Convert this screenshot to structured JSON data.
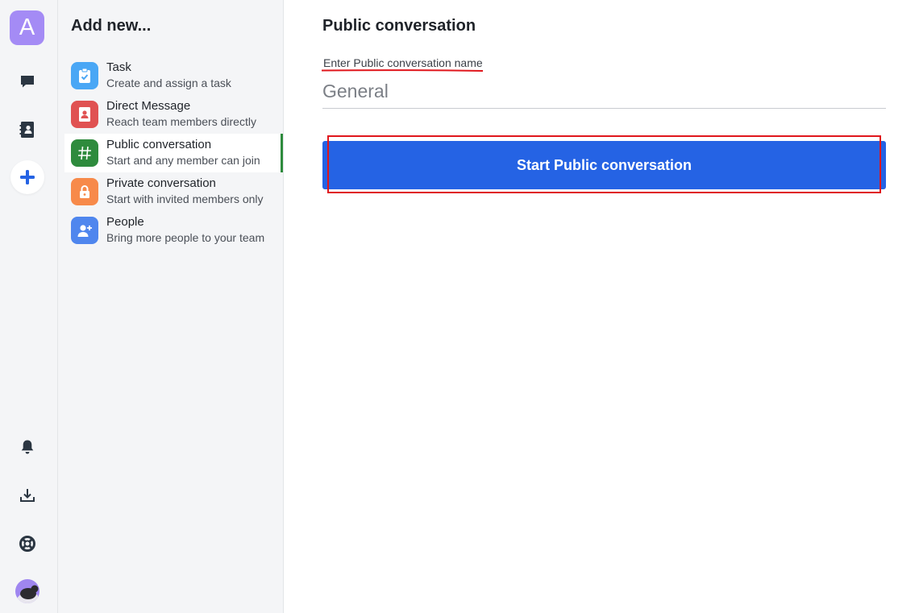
{
  "rail": {
    "workspace_initial": "A",
    "items": [
      {
        "name": "chat-bubble-icon"
      },
      {
        "name": "contacts-book-icon"
      },
      {
        "name": "plus-icon",
        "active": true
      },
      {
        "name": "bell-icon"
      },
      {
        "name": "download-icon"
      },
      {
        "name": "lifebuoy-icon"
      }
    ]
  },
  "panel": {
    "title": "Add new...",
    "items": [
      {
        "label": "Task",
        "description": "Create and assign a task",
        "icon": "clipboard-check-icon",
        "color": "#4aa7f5"
      },
      {
        "label": "Direct Message",
        "description": "Reach team members directly",
        "icon": "contact-card-icon",
        "color": "#e05252"
      },
      {
        "label": "Public conversation",
        "description": "Start and any member can join",
        "icon": "hash-icon",
        "color": "#2e8b3d",
        "selected": true
      },
      {
        "label": "Private conversation",
        "description": "Start with invited members only",
        "icon": "lock-icon",
        "color": "#f78a4a"
      },
      {
        "label": "People",
        "description": "Bring more people to your team",
        "icon": "add-person-icon",
        "color": "#4f86ee"
      }
    ]
  },
  "form": {
    "title": "Public conversation",
    "field_label": "Enter Public conversation name",
    "field_value": "General",
    "submit_label": "Start Public conversation"
  },
  "colors": {
    "accent": "#2563e4",
    "selected_indicator": "#2e8b3d",
    "workspace_avatar": "#a48bf5",
    "annotation_red": "#e0161c"
  }
}
